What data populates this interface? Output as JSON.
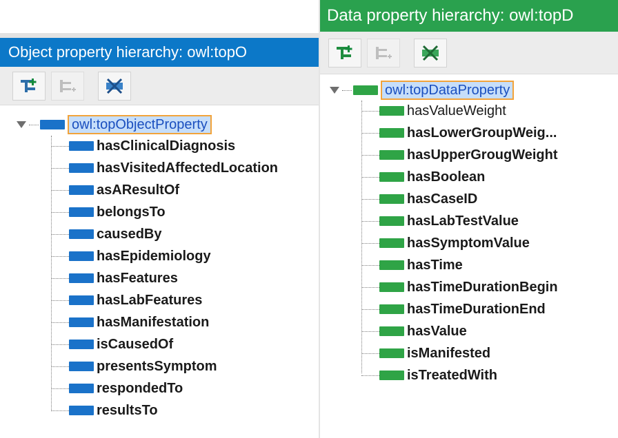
{
  "object_panel": {
    "title": "Object property hierarchy: owl:topO",
    "root_label": "owl:topObjectProperty",
    "items": [
      {
        "label": "hasClinicalDiagnosis"
      },
      {
        "label": "hasVisitedAffectedLocation"
      },
      {
        "label": "asAResultOf"
      },
      {
        "label": "belongsTo"
      },
      {
        "label": "causedBy"
      },
      {
        "label": "hasEpidemiology"
      },
      {
        "label": "hasFeatures"
      },
      {
        "label": "hasLabFeatures"
      },
      {
        "label": "hasManifestation"
      },
      {
        "label": "isCausedOf"
      },
      {
        "label": "presentsSymptom"
      },
      {
        "label": "respondedTo"
      },
      {
        "label": "resultsTo"
      }
    ]
  },
  "data_panel": {
    "title": "Data property hierarchy: owl:topD",
    "root_label": "owl:topDataProperty",
    "items": [
      {
        "label": "hasValueWeight"
      },
      {
        "label": "hasLowerGroupWeig..."
      },
      {
        "label": "hasUpperGrougWeight"
      },
      {
        "label": "hasBoolean"
      },
      {
        "label": "hasCaseID"
      },
      {
        "label": "hasLabTestValue"
      },
      {
        "label": "hasSymptomValue"
      },
      {
        "label": "hasTime"
      },
      {
        "label": "hasTimeDurationBegin"
      },
      {
        "label": "hasTimeDurationEnd"
      },
      {
        "label": "hasValue"
      },
      {
        "label": "isManifested"
      },
      {
        "label": "isTreatedWith"
      }
    ]
  },
  "colors": {
    "object_title_bar": "#0c78c8",
    "data_title_bar": "#2aa14e",
    "object_property_icon": "#1a72c9",
    "data_property_icon": "#2fa446",
    "selection_border": "#f2a33a",
    "selection_fill": "#c6defa"
  },
  "icons": {
    "add_sub_property": "add-sub-property-icon",
    "add_sibling_property": "add-sibling-property-icon",
    "delete_property": "delete-property-icon"
  }
}
